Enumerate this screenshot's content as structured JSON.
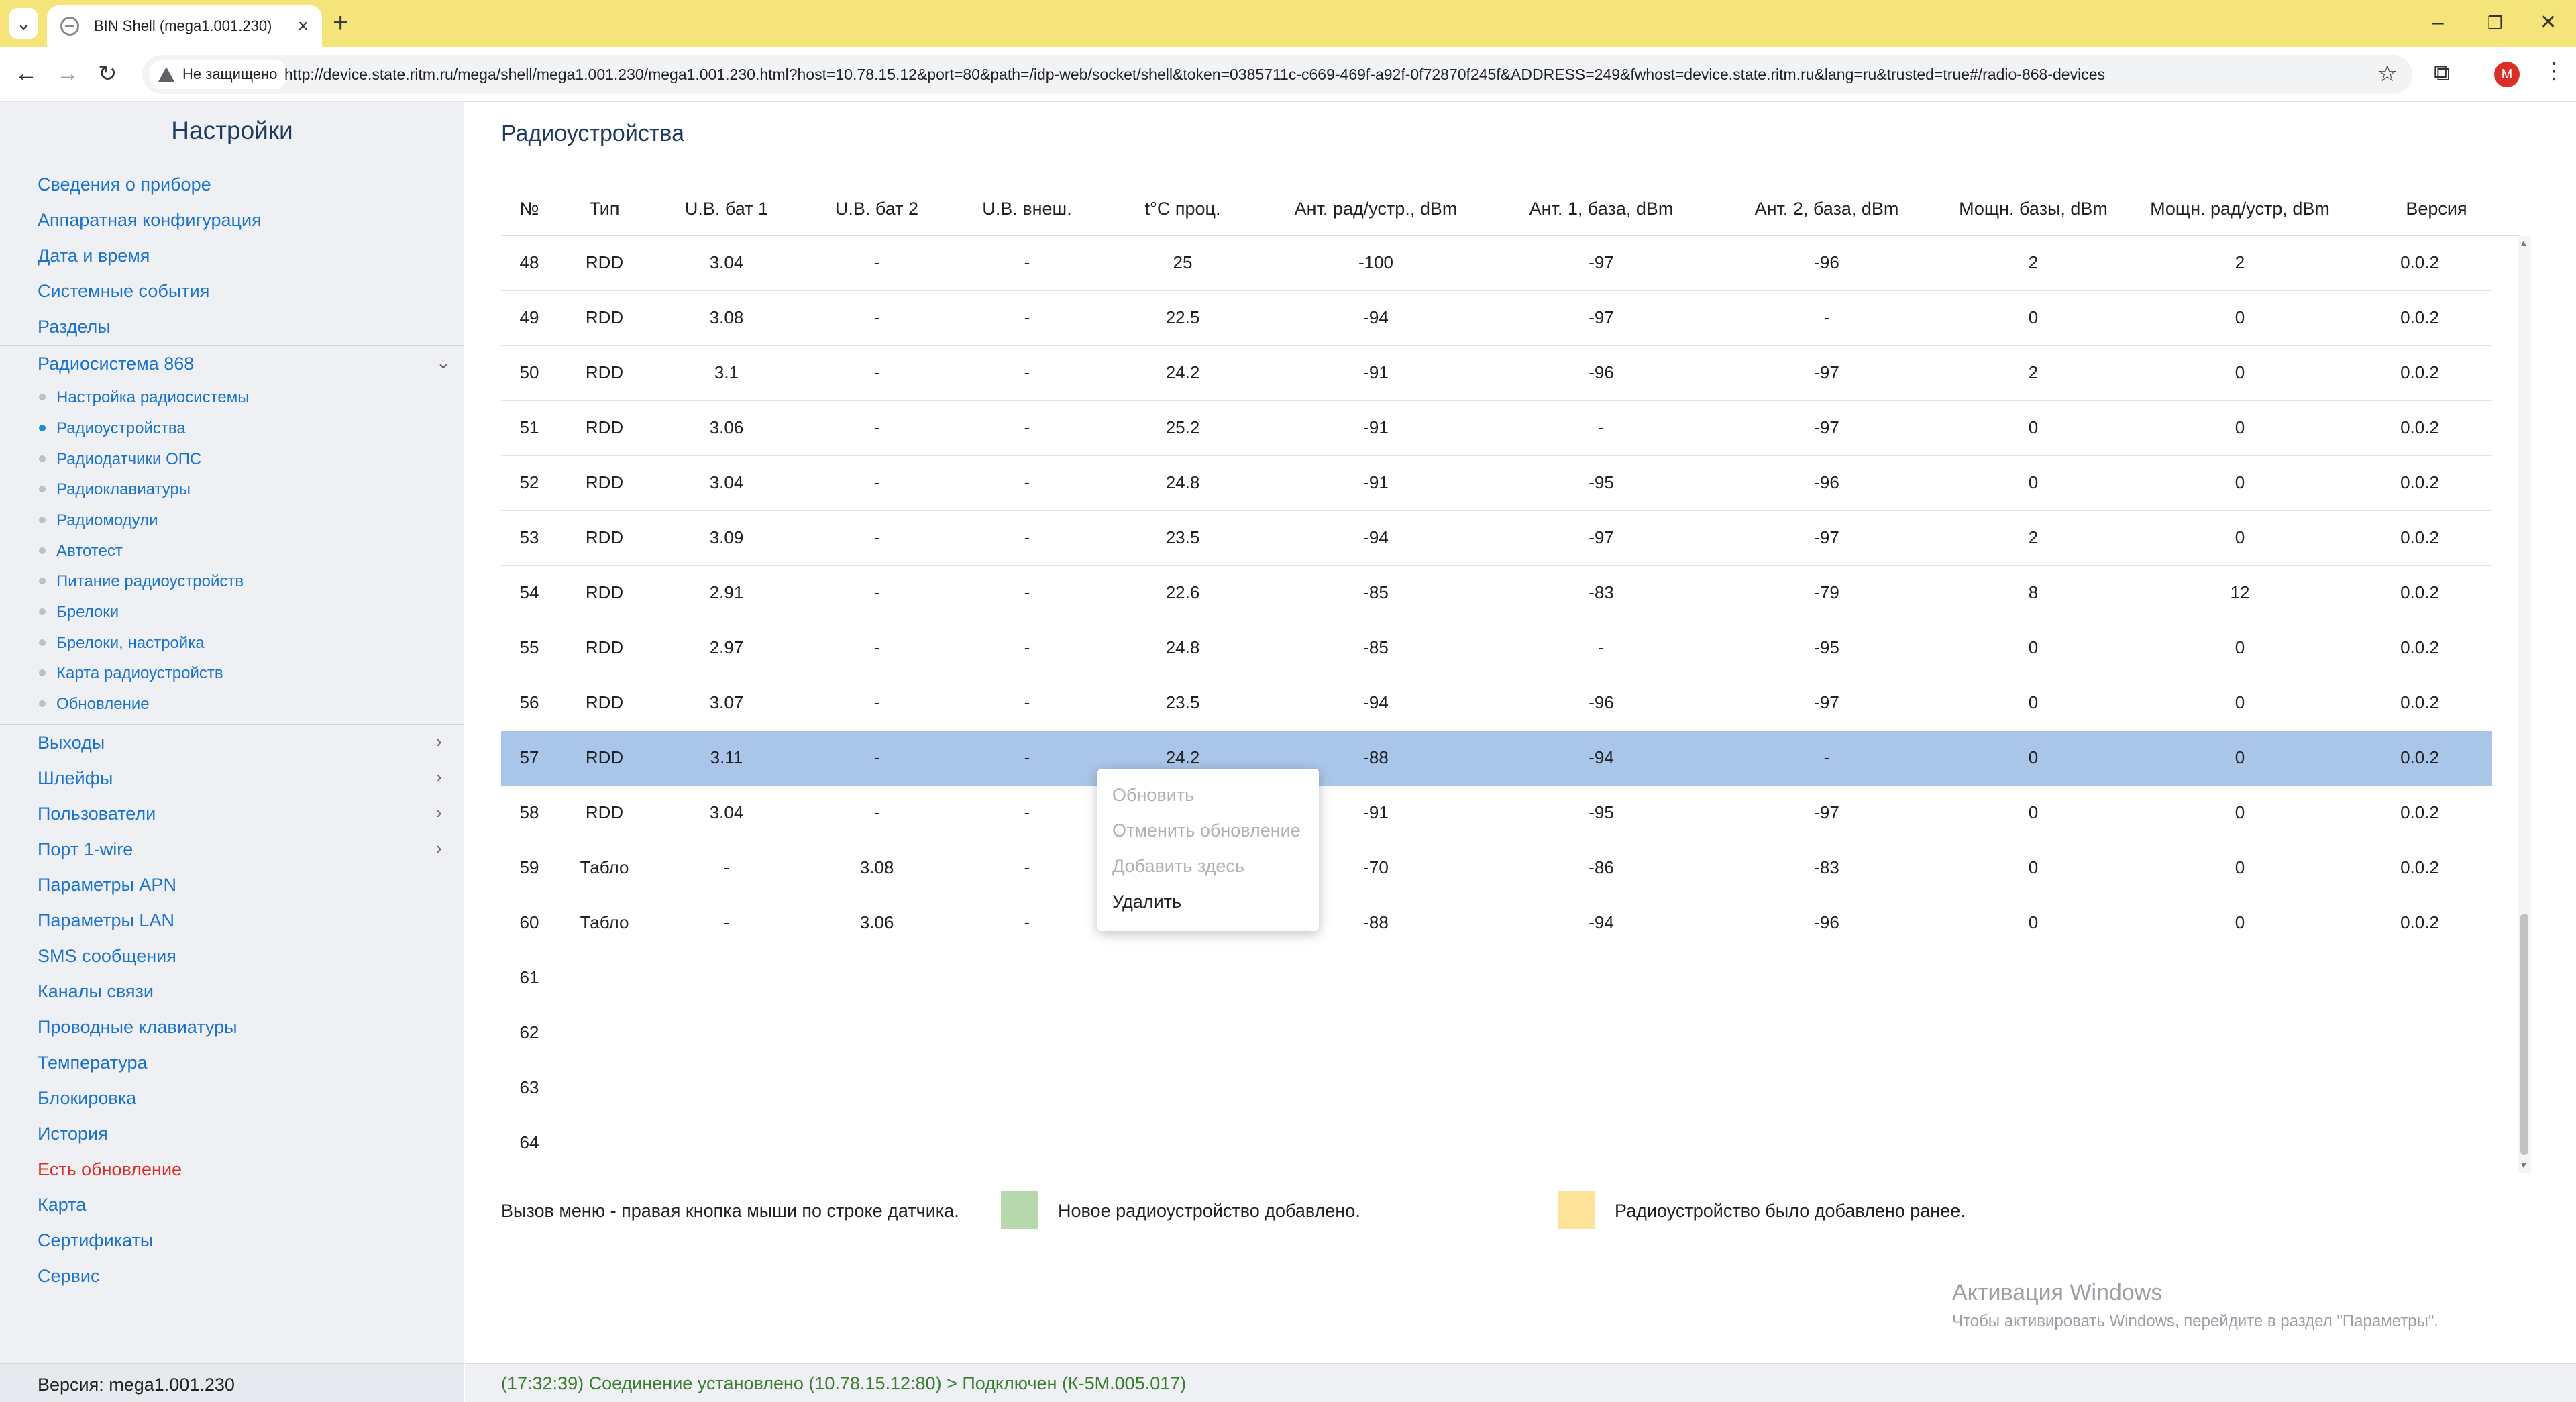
{
  "browser": {
    "tab_title": "BIN Shell (mega1.001.230)",
    "security_label": "Не защищено",
    "url": "http://device.state.ritm.ru/mega/shell/mega1.001.230/mega1.001.230.html?host=10.78.15.12&port=80&path=/idp-web/socket/shell&token=0385711c-c669-469f-a92f-0f72870f245f&ADDRESS=249&fwhost=device.state.ritm.ru&lang=ru&trusted=true#/radio-868-devices",
    "profile_initial": "M"
  },
  "sidebar": {
    "title": "Настройки",
    "items_top": [
      "Сведения о приборе",
      "Аппаратная конфигурация",
      "Дата и время",
      "Системные события",
      "Разделы"
    ],
    "radio_section": "Радиосистема 868",
    "sub_items": [
      "Настройка радиосистемы",
      "Радиоустройства",
      "Радиодатчики ОПС",
      "Радиоклавиатуры",
      "Радиомодули",
      "Автотест",
      "Питание радиоустройств",
      "Брелоки",
      "Брелоки, настройка",
      "Карта радиоустройств",
      "Обновление"
    ],
    "items_expand": [
      "Выходы",
      "Шлейфы",
      "Пользователи",
      "Порт 1-wire"
    ],
    "items_bottom": [
      "Параметры APN",
      "Параметры LAN",
      "SMS сообщения",
      "Каналы связи",
      "Проводные клавиатуры",
      "Температура",
      "Блокировка",
      "История",
      "Есть обновление",
      "Карта",
      "Сертификаты",
      "Сервис"
    ],
    "version": "Версия: mega1.001.230"
  },
  "main": {
    "title": "Радиоустройства",
    "columns": [
      "№",
      "Тип",
      "U.B. бат 1",
      "U.B. бат 2",
      "U.B. внеш.",
      "t°C проц.",
      "Ант. рад/устр., dBm",
      "Ант. 1, база, dBm",
      "Ант. 2, база, dBm",
      "Мощн. базы, dBm",
      "Мощн. рад/устр, dBm",
      "Версия"
    ],
    "rows": [
      [
        "48",
        "RDD",
        "3.04",
        "-",
        "-",
        "25",
        "-100",
        "-97",
        "-96",
        "2",
        "2",
        "0.0.2"
      ],
      [
        "49",
        "RDD",
        "3.08",
        "-",
        "-",
        "22.5",
        "-94",
        "-97",
        "-",
        "0",
        "0",
        "0.0.2"
      ],
      [
        "50",
        "RDD",
        "3.1",
        "-",
        "-",
        "24.2",
        "-91",
        "-96",
        "-97",
        "2",
        "0",
        "0.0.2"
      ],
      [
        "51",
        "RDD",
        "3.06",
        "-",
        "-",
        "25.2",
        "-91",
        "-",
        "-97",
        "0",
        "0",
        "0.0.2"
      ],
      [
        "52",
        "RDD",
        "3.04",
        "-",
        "-",
        "24.8",
        "-91",
        "-95",
        "-96",
        "0",
        "0",
        "0.0.2"
      ],
      [
        "53",
        "RDD",
        "3.09",
        "-",
        "-",
        "23.5",
        "-94",
        "-97",
        "-97",
        "2",
        "0",
        "0.0.2"
      ],
      [
        "54",
        "RDD",
        "2.91",
        "-",
        "-",
        "22.6",
        "-85",
        "-83",
        "-79",
        "8",
        "12",
        "0.0.2"
      ],
      [
        "55",
        "RDD",
        "2.97",
        "-",
        "-",
        "24.8",
        "-85",
        "-",
        "-95",
        "0",
        "0",
        "0.0.2"
      ],
      [
        "56",
        "RDD",
        "3.07",
        "-",
        "-",
        "23.5",
        "-94",
        "-96",
        "-97",
        "0",
        "0",
        "0.0.2"
      ],
      [
        "57",
        "RDD",
        "3.11",
        "-",
        "-",
        "24.2",
        "-88",
        "-94",
        "-",
        "0",
        "0",
        "0.0.2"
      ],
      [
        "58",
        "RDD",
        "3.04",
        "-",
        "-",
        "",
        "-91",
        "-95",
        "-97",
        "0",
        "0",
        "0.0.2"
      ],
      [
        "59",
        "Табло",
        "-",
        "3.08",
        "-",
        "",
        "-70",
        "-86",
        "-83",
        "0",
        "0",
        "0.0.2"
      ],
      [
        "60",
        "Табло",
        "-",
        "3.06",
        "-",
        "",
        "-88",
        "-94",
        "-96",
        "0",
        "0",
        "0.0.2"
      ],
      [
        "61",
        "",
        "",
        "",
        "",
        "",
        "",
        "",
        "",
        "",
        "",
        ""
      ],
      [
        "62",
        "",
        "",
        "",
        "",
        "",
        "",
        "",
        "",
        "",
        "",
        ""
      ],
      [
        "63",
        "",
        "",
        "",
        "",
        "",
        "",
        "",
        "",
        "",
        "",
        ""
      ],
      [
        "64",
        "",
        "",
        "",
        "",
        "",
        "",
        "",
        "",
        "",
        "",
        ""
      ]
    ],
    "selected_row": "57",
    "context_menu": {
      "items": [
        "Обновить",
        "Отменить обновление",
        "Добавить здесь",
        "Удалить"
      ],
      "enabled": [
        false,
        false,
        false,
        true
      ]
    },
    "legend": {
      "hint": "Вызов меню - правая кнопка мыши по строке датчика.",
      "new_label": "Новое радиоустройство добавлено.",
      "new_color": "#b5d9ac",
      "old_label": "Радиоустройство было добавлено ранее.",
      "old_color": "#fde49a"
    },
    "windows_activation": {
      "title": "Активация Windows",
      "subtitle": "Чтобы активировать Windows, перейдите в раздел \"Параметры\"."
    },
    "status": "(17:32:39) Соединение установлено (10.78.15.12:80) > Подключен (К-5М.005.017)"
  }
}
